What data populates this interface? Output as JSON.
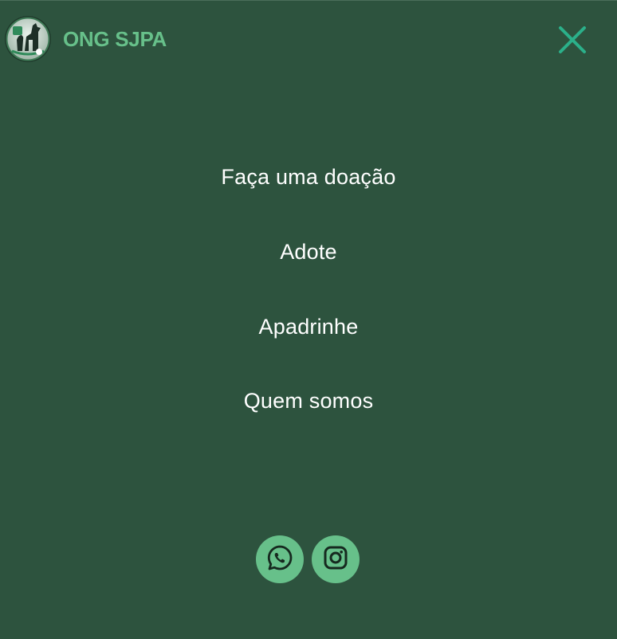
{
  "header": {
    "brand_name": "ONG SJPA",
    "logo_icon": "ong-logo-dog-cat-icon",
    "close_icon": "close-x-icon"
  },
  "menu": {
    "items": [
      {
        "label": "Faça uma doação"
      },
      {
        "label": "Adote"
      },
      {
        "label": "Apadrinhe"
      },
      {
        "label": "Quem somos"
      }
    ]
  },
  "social": {
    "whatsapp_icon": "whatsapp-icon",
    "instagram_icon": "instagram-icon"
  },
  "colors": {
    "background": "#2d533e",
    "accent": "#67c08a",
    "close": "#2bb08a",
    "text": "#ffffff"
  }
}
